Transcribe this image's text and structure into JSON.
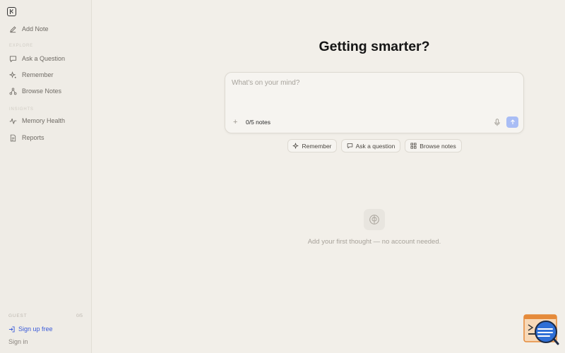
{
  "sidebar": {
    "add_note": "Add Note",
    "section_explore": "EXPLORE",
    "ask_question": "Ask a Question",
    "remember": "Remember",
    "browse_notes": "Browse Notes",
    "section_insights": "INSIGHTS",
    "memory_health": "Memory Health",
    "reports": "Reports",
    "guest_label": "GUEST",
    "guest_count": "0/5",
    "sign_up": "Sign up free",
    "sign_in": "Sign in"
  },
  "main": {
    "title": "Getting smarter?",
    "composer": {
      "placeholder": "What's on your mind?",
      "value": "",
      "note_count": "0/5 notes"
    },
    "chips": {
      "remember": "Remember",
      "ask": "Ask a question",
      "browse": "Browse notes"
    },
    "empty_text": "Add your first thought — no account needed."
  },
  "colors": {
    "accent": "#3b5bd9",
    "send_button": "#a9bdf5",
    "background": "#f2efe9"
  },
  "icons": {
    "collapse": "sidebar-collapse-icon",
    "add_note": "pencil-icon",
    "ask": "chat-bubble-icon",
    "remember": "sparkle-icon",
    "browse": "graph-icon",
    "health": "pulse-icon",
    "reports": "document-icon",
    "sign_up": "login-icon",
    "mic": "microphone-icon",
    "send": "arrow-up-icon",
    "brain": "brain-icon"
  }
}
